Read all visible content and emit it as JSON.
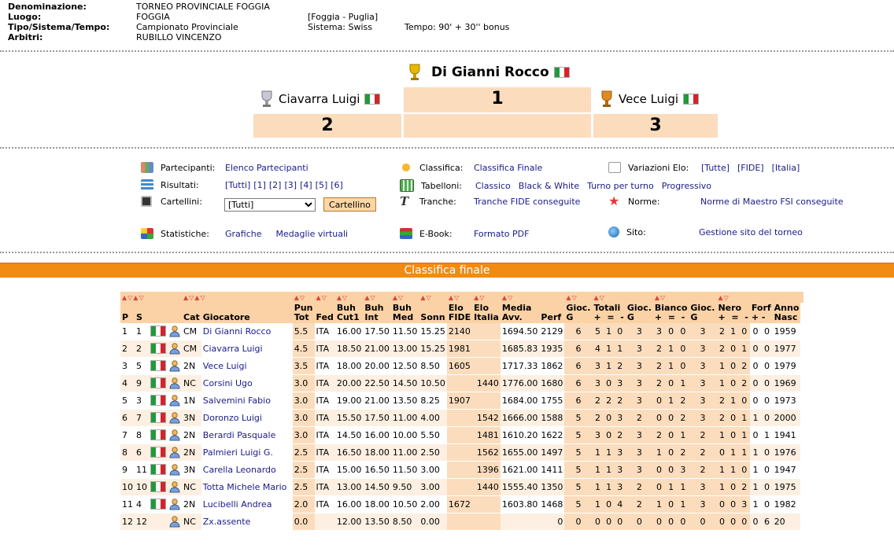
{
  "header": {
    "labels": {
      "denominazione": "Denominazione:",
      "luogo": "Luogo:",
      "tipo": "Tipo/Sistema/Tempo:",
      "arbitri": "Arbitri:"
    },
    "denominazione": "TORNEO PROVINCIALE FOGGIA",
    "luogo": "FOGGIA",
    "luogo_region": "[Foggia - Puglia]",
    "tipo": "Campionato Provinciale",
    "sistema": "Sistema:  Swiss",
    "tempo": "Tempo:  90' + 30'' bonus",
    "arbitri": "RUBILLO VINCENZO"
  },
  "podium": {
    "first": {
      "name": "Di Gianni Rocco",
      "pos": "1"
    },
    "second": {
      "name": "Ciavarra Luigi",
      "pos": "2"
    },
    "third": {
      "name": "Vece Luigi",
      "pos": "3"
    }
  },
  "menu": {
    "partecipanti": {
      "label": "Partecipanti:",
      "link": "Elenco Partecipanti"
    },
    "risultati": {
      "label": "Risultati:",
      "links": [
        "[Tutti]",
        "[1]",
        "[2]",
        "[3]",
        "[4]",
        "[5]",
        "[6]"
      ]
    },
    "cartellini": {
      "label": "Cartellini:",
      "selected": "[Tutti]",
      "button": "Cartellino"
    },
    "statistiche": {
      "label": "Statistiche:",
      "links": [
        "Grafiche",
        "Medaglie virtuali"
      ]
    },
    "classifica": {
      "label": "Classifica:",
      "link": "Classifica Finale"
    },
    "tabelloni": {
      "label": "Tabelloni:",
      "links": [
        "Classico",
        "Black & White",
        "Turno per turno",
        "Progressivo"
      ]
    },
    "tranche": {
      "label": "Tranche:",
      "link": "Tranche FIDE conseguite"
    },
    "ebook": {
      "label": "E-Book:",
      "link": "Formato PDF"
    },
    "elo": {
      "label": "Variazioni Elo:",
      "links": [
        "[Tutte]",
        "[FIDE]",
        "[Italia]"
      ]
    },
    "norme": {
      "label": "Norme:",
      "link": "Norme di Maestro FSI conseguite"
    },
    "sito": {
      "label": "Sito:",
      "link": "Gestione sito del torneo"
    }
  },
  "band_title": "Classifica finale",
  "table": {
    "headers": {
      "p": "P",
      "s": "S",
      "cat": "Cat",
      "giocatore": "Giocatore",
      "pun1": "Pun",
      "pun2": "Tot",
      "fed": "Fed",
      "buhc1": "Buh",
      "buhc2": "Cut1",
      "buhi1": "Buh",
      "buhi2": "Int",
      "buhm1": "Buh",
      "buhm2": "Med",
      "sonn": "Sonn",
      "elof1": "Elo",
      "elof2": "FIDE",
      "eloi1": "Elo",
      "eloi2": "Italia",
      "media1": "Media",
      "media2": "Avv.",
      "perf": "Perf",
      "gioc1": "Gioc.",
      "gioc1b": "G",
      "tot1": "Totali",
      "plus": "+",
      "eq": "=",
      "minus": "-",
      "gioc2": "Gioc.",
      "gioc2b": "G",
      "bianco": "Bianco",
      "gioc3": "Gioc.",
      "gioc3b": "G",
      "nero": "Nero",
      "forf": "Forf",
      "anno1": "Anno",
      "anno2": "Nasc"
    },
    "rows": [
      {
        "p": "1",
        "s": "1",
        "flag": true,
        "cat": "CM",
        "name": "Di Gianni Rocco",
        "pun": "5.5",
        "fed": "ITA",
        "buhc": "16.00",
        "buhi": "17.50",
        "buhm": "11.50",
        "sonn": "15.25",
        "elof": "2140",
        "eloi": "",
        "media": "1694.50",
        "perf": "2129",
        "t": [
          "6",
          "5",
          "1",
          "0"
        ],
        "b": [
          "3",
          "3",
          "0",
          "0"
        ],
        "n": [
          "3",
          "2",
          "1",
          "0"
        ],
        "f": [
          "0",
          "0"
        ],
        "anno": "1959"
      },
      {
        "p": "2",
        "s": "2",
        "flag": true,
        "cat": "CM",
        "name": "Ciavarra Luigi",
        "pun": "4.5",
        "fed": "ITA",
        "buhc": "18.50",
        "buhi": "21.00",
        "buhm": "13.00",
        "sonn": "15.25",
        "elof": "1981",
        "eloi": "",
        "media": "1685.83",
        "perf": "1935",
        "t": [
          "6",
          "4",
          "1",
          "1"
        ],
        "b": [
          "3",
          "2",
          "1",
          "0"
        ],
        "n": [
          "3",
          "2",
          "0",
          "1"
        ],
        "f": [
          "0",
          "0"
        ],
        "anno": "1977"
      },
      {
        "p": "3",
        "s": "5",
        "flag": true,
        "cat": "2N",
        "name": "Vece Luigi",
        "pun": "3.5",
        "fed": "ITA",
        "buhc": "18.00",
        "buhi": "20.00",
        "buhm": "12.50",
        "sonn": "8.50",
        "elof": "1605",
        "eloi": "",
        "media": "1717.33",
        "perf": "1862",
        "t": [
          "6",
          "3",
          "1",
          "2"
        ],
        "b": [
          "3",
          "2",
          "1",
          "0"
        ],
        "n": [
          "3",
          "1",
          "0",
          "2"
        ],
        "f": [
          "0",
          "0"
        ],
        "anno": "1979"
      },
      {
        "p": "4",
        "s": "9",
        "flag": true,
        "cat": "NC",
        "name": "Corsini Ugo",
        "pun": "3.0",
        "fed": "ITA",
        "buhc": "20.00",
        "buhi": "22.50",
        "buhm": "14.50",
        "sonn": "10.50",
        "elof": "",
        "eloi": "1440",
        "media": "1776.00",
        "perf": "1680",
        "t": [
          "6",
          "3",
          "0",
          "3"
        ],
        "b": [
          "3",
          "2",
          "0",
          "1"
        ],
        "n": [
          "3",
          "1",
          "0",
          "2"
        ],
        "f": [
          "0",
          "0"
        ],
        "anno": "1969"
      },
      {
        "p": "5",
        "s": "3",
        "flag": true,
        "cat": "1N",
        "name": "Salvemini Fabio",
        "pun": "3.0",
        "fed": "ITA",
        "buhc": "19.00",
        "buhi": "21.00",
        "buhm": "13.50",
        "sonn": "8.25",
        "elof": "1907",
        "eloi": "",
        "media": "1684.00",
        "perf": "1755",
        "t": [
          "6",
          "2",
          "2",
          "2"
        ],
        "b": [
          "3",
          "0",
          "1",
          "2"
        ],
        "n": [
          "3",
          "2",
          "1",
          "0"
        ],
        "f": [
          "0",
          "0"
        ],
        "anno": "1973"
      },
      {
        "p": "6",
        "s": "7",
        "flag": true,
        "cat": "3N",
        "name": "Doronzo Luigi",
        "pun": "3.0",
        "fed": "ITA",
        "buhc": "15.50",
        "buhi": "17.50",
        "buhm": "11.00",
        "sonn": "4.00",
        "elof": "",
        "eloi": "1542",
        "media": "1666.00",
        "perf": "1588",
        "t": [
          "5",
          "2",
          "0",
          "3"
        ],
        "b": [
          "2",
          "0",
          "0",
          "2"
        ],
        "n": [
          "3",
          "2",
          "0",
          "1"
        ],
        "f": [
          "1",
          "0"
        ],
        "anno": "2000"
      },
      {
        "p": "7",
        "s": "8",
        "flag": true,
        "cat": "2N",
        "name": "Berardi Pasquale",
        "pun": "3.0",
        "fed": "ITA",
        "buhc": "14.50",
        "buhi": "16.00",
        "buhm": "10.00",
        "sonn": "5.50",
        "elof": "",
        "eloi": "1481",
        "media": "1610.20",
        "perf": "1622",
        "t": [
          "5",
          "3",
          "0",
          "2"
        ],
        "b": [
          "3",
          "2",
          "0",
          "1"
        ],
        "n": [
          "2",
          "1",
          "0",
          "1"
        ],
        "f": [
          "0",
          "1"
        ],
        "anno": "1941"
      },
      {
        "p": "8",
        "s": "6",
        "flag": true,
        "cat": "2N",
        "name": "Palmieri Luigi G.",
        "pun": "2.5",
        "fed": "ITA",
        "buhc": "16.50",
        "buhi": "18.00",
        "buhm": "11.00",
        "sonn": "2.50",
        "elof": "",
        "eloi": "1562",
        "media": "1655.00",
        "perf": "1497",
        "t": [
          "5",
          "1",
          "1",
          "3"
        ],
        "b": [
          "3",
          "1",
          "0",
          "2"
        ],
        "n": [
          "2",
          "0",
          "1",
          "1"
        ],
        "f": [
          "1",
          "0"
        ],
        "anno": "1976"
      },
      {
        "p": "9",
        "s": "11",
        "flag": true,
        "cat": "3N",
        "name": "Carella Leonardo",
        "pun": "2.5",
        "fed": "ITA",
        "buhc": "15.00",
        "buhi": "16.50",
        "buhm": "11.50",
        "sonn": "3.00",
        "elof": "",
        "eloi": "1396",
        "media": "1621.00",
        "perf": "1411",
        "t": [
          "5",
          "1",
          "1",
          "3"
        ],
        "b": [
          "3",
          "0",
          "0",
          "3"
        ],
        "n": [
          "2",
          "1",
          "1",
          "0"
        ],
        "f": [
          "1",
          "0"
        ],
        "anno": "1947"
      },
      {
        "p": "10",
        "s": "10",
        "flag": true,
        "cat": "NC",
        "name": "Totta Michele Mario",
        "pun": "2.5",
        "fed": "ITA",
        "buhc": "13.00",
        "buhi": "14.50",
        "buhm": "9.50",
        "sonn": "3.00",
        "elof": "",
        "eloi": "1440",
        "media": "1555.40",
        "perf": "1350",
        "t": [
          "5",
          "1",
          "1",
          "3"
        ],
        "b": [
          "2",
          "0",
          "1",
          "1"
        ],
        "n": [
          "3",
          "1",
          "0",
          "2"
        ],
        "f": [
          "1",
          "0"
        ],
        "anno": "1975"
      },
      {
        "p": "11",
        "s": "4",
        "flag": true,
        "cat": "2N",
        "name": "Lucibelli Andrea",
        "pun": "2.0",
        "fed": "ITA",
        "buhc": "16.00",
        "buhi": "18.00",
        "buhm": "10.50",
        "sonn": "2.00",
        "elof": "1672",
        "eloi": "",
        "media": "1603.80",
        "perf": "1468",
        "t": [
          "5",
          "1",
          "0",
          "4"
        ],
        "b": [
          "2",
          "1",
          "0",
          "1"
        ],
        "n": [
          "3",
          "0",
          "0",
          "3"
        ],
        "f": [
          "1",
          "0"
        ],
        "anno": "1982"
      },
      {
        "p": "12",
        "s": "12",
        "flag": false,
        "cat": "NC",
        "name": "Zx.assente",
        "pun": "0.0",
        "fed": "",
        "buhc": "12.00",
        "buhi": "13.50",
        "buhm": "8.50",
        "sonn": "0.00",
        "elof": "",
        "eloi": "",
        "media": "",
        "perf": "0",
        "t": [
          "0",
          "0",
          "0",
          "0"
        ],
        "b": [
          "0",
          "0",
          "0",
          "0"
        ],
        "n": [
          "0",
          "0",
          "0",
          "0"
        ],
        "f": [
          "0",
          "6"
        ],
        "anno": "20"
      }
    ]
  }
}
